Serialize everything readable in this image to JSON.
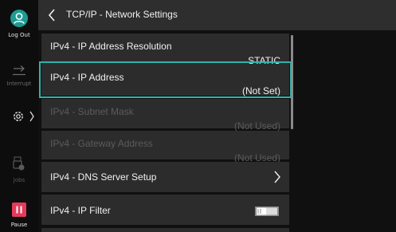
{
  "sidebar": {
    "logout_label": "Log Out",
    "interrupt_label": "Interrupt",
    "jobs_label": "Jobs",
    "pause_label": "Pause"
  },
  "header": {
    "title": "TCP/IP - Network Settings"
  },
  "settings": [
    {
      "label": "IPv4 - IP Address Resolution",
      "value": "STATIC",
      "state": "enabled"
    },
    {
      "label": "IPv4 - IP Address",
      "value": "(Not Set)",
      "state": "selected"
    },
    {
      "label": "IPv4 - Subnet Mask",
      "value": "(Not Used)",
      "state": "disabled"
    },
    {
      "label": "IPv4 - Gateway Address",
      "value": "(Not Used)",
      "state": "disabled"
    },
    {
      "label": "IPv4 - DNS Server Setup",
      "value": "",
      "state": "enabled"
    },
    {
      "label": "IPv4 - IP Filter",
      "value": "",
      "state": "enabled",
      "toggle": "off"
    }
  ],
  "colors": {
    "accent": "#2fb3aa",
    "avatar": "#1f9a93",
    "pause": "#e53a5c"
  }
}
